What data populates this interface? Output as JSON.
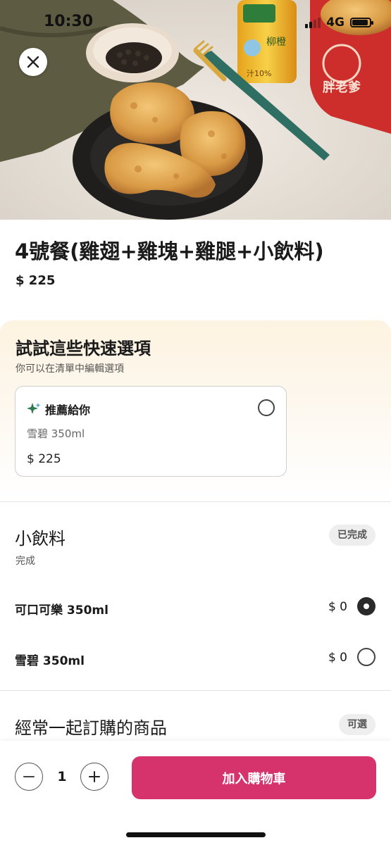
{
  "status_bar": {
    "time": "10:30",
    "network": "4G"
  },
  "hero": {
    "can_text": "柳橙",
    "can_badge": "汁10%",
    "box_text": "胖老爹"
  },
  "product": {
    "title": "4號餐(雞翅+雞塊+雞腿+小飲料)",
    "price": "$ 225"
  },
  "quick_options": {
    "title": "試試這些快速選項",
    "subtitle": "你可以在清單中編輯選項",
    "card": {
      "label": "推薦給你",
      "item": "雪碧 350ml",
      "price": "$ 225",
      "icon": "sparkle-icon"
    }
  },
  "drink_section": {
    "title": "小飲料",
    "status": "完成",
    "badge": "已完成",
    "options": [
      {
        "name": "可口可樂 350ml",
        "price": "$ 0",
        "selected": true
      },
      {
        "name": "雪碧 350ml",
        "price": "$ 0",
        "selected": false
      }
    ]
  },
  "frequent_section": {
    "title": "經常一起訂購的商品",
    "badge": "可選"
  },
  "cart_bar": {
    "quantity": "1",
    "add_label": "加入購物車"
  },
  "colors": {
    "accent": "#d6336c",
    "radio_on": "#2a2a2a",
    "quick_bg": "#fdf3e1"
  }
}
